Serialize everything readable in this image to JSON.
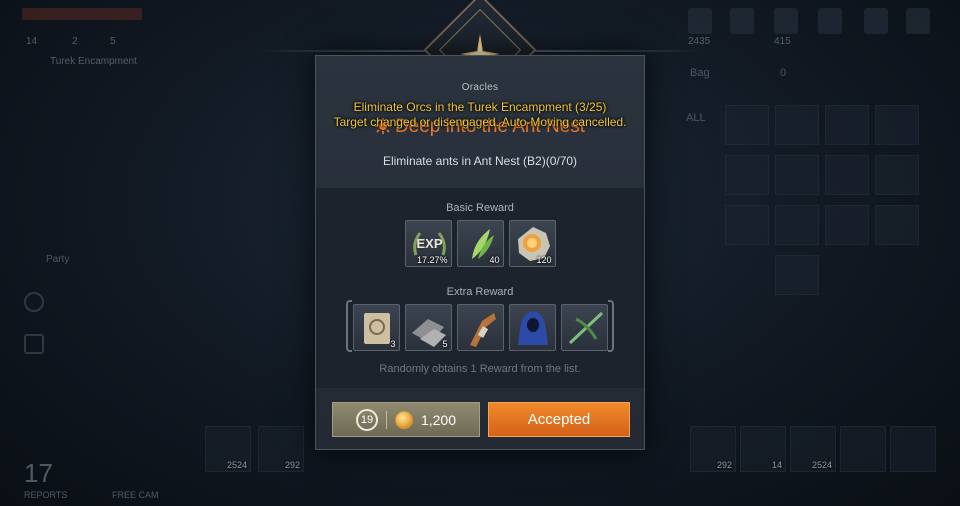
{
  "background": {
    "top_stats": [
      "14",
      "2",
      "5"
    ],
    "quest_text": "Turek Encampment",
    "party_label": "Party",
    "bag_label": "Bag",
    "bag_count": "0",
    "all_label": "ALL",
    "bottom_level": "17",
    "bottom_labels": [
      "REPORTS",
      "FREE CAM"
    ],
    "slot_counts": [
      "2524",
      "292",
      "292",
      "14",
      "2524"
    ],
    "top_right_values": [
      "2435",
      "415"
    ]
  },
  "emblem": {
    "label": "Oracles"
  },
  "notices": {
    "line1": "Eliminate Orcs in the Turek Encampment (3/25)",
    "line2": "Target changed or disengaged. Auto-Moving cancelled."
  },
  "quest": {
    "title": "Deep into the Ant Nest",
    "description": "Eliminate ants in Ant Nest (B2)(0/70)"
  },
  "basic_reward": {
    "title": "Basic Reward",
    "items": [
      {
        "name": "exp",
        "label": "EXP",
        "qty": "17.27%"
      },
      {
        "name": "herb",
        "label": "",
        "qty": "40"
      },
      {
        "name": "gold-pouch",
        "label": "",
        "qty": "120"
      }
    ]
  },
  "extra_reward": {
    "title": "Extra Reward",
    "items": [
      {
        "name": "scroll",
        "qty": "3"
      },
      {
        "name": "ore",
        "qty": "5"
      },
      {
        "name": "gauntlet",
        "qty": ""
      },
      {
        "name": "cloak",
        "qty": ""
      },
      {
        "name": "crossbow",
        "qty": ""
      }
    ],
    "note": "Randomly obtains 1 Reward from the list."
  },
  "actions": {
    "cost_level": "19",
    "cost_amount": "1,200",
    "accept_label": "Accepted"
  },
  "colors": {
    "accent_orange": "#e8782a",
    "notice_yellow": "#f0c532",
    "button_orange": "#e0701f"
  }
}
